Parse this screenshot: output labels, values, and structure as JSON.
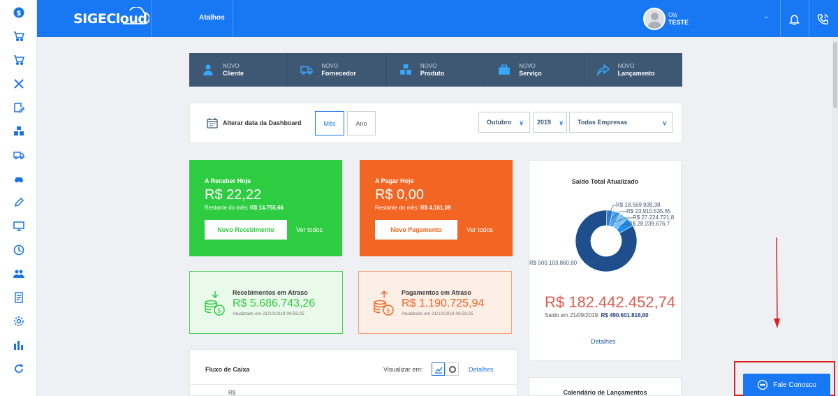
{
  "topbar": {
    "logo": "SIGECloud",
    "shortcuts_label": "Atalhos",
    "greeting": "Olá",
    "user_name": "TESTE"
  },
  "sidebar": {
    "icons": [
      "dollar-icon",
      "cart-icon",
      "cart-check-icon",
      "tools-icon",
      "edit-icon",
      "boxes-icon",
      "truck-icon",
      "car-icon",
      "pencil-icon",
      "monitor-icon",
      "clock-icon",
      "users-icon",
      "report-icon",
      "gear-icon",
      "bar-chart-icon",
      "refresh-icon"
    ]
  },
  "quickbar": {
    "items": [
      {
        "small": "NOVO",
        "label": "Cliente",
        "icon": "person-icon"
      },
      {
        "small": "NOVO",
        "label": "Fornecedor",
        "icon": "truck-icon"
      },
      {
        "small": "NOVO",
        "label": "Produto",
        "icon": "boxes-icon"
      },
      {
        "small": "NOVO",
        "label": "Serviço",
        "icon": "briefcase-icon"
      },
      {
        "small": "NOVO",
        "label": "Lançamento",
        "icon": "share-icon"
      }
    ]
  },
  "filters": {
    "label": "Alterar data da Dashboard",
    "month_btn": "Mês",
    "year_btn": "Ano",
    "month": "Outubro",
    "year": "2019",
    "company": "Todas Empresas"
  },
  "receber": {
    "title": "A Receber Hoje",
    "value": "R$ 22,22",
    "rest_label": "Restante do mês:",
    "rest_value": "R$ 14.755,66",
    "button": "Novo Recebimento",
    "link": "Ver todos",
    "color": "#2ecc40"
  },
  "pagar": {
    "title": "A Pagar Hoje",
    "value": "R$ 0,00",
    "rest_label": "Restante do mês:",
    "rest_value": "R$ 4.161,09",
    "button": "Novo Pagamento",
    "link": "Ver todos",
    "color": "#f26522"
  },
  "atraso_receb": {
    "title": "Recebimentos em Atraso",
    "value": "R$ 5.686.743,26",
    "updated": "Atualizado em 21/10/2019 08:56:25"
  },
  "atraso_pag": {
    "title": "Pagamentos em Atraso",
    "value": "R$ 1.190.725,94",
    "updated": "Atualizado em 21/10/2019 08:56:25"
  },
  "cashflow": {
    "title": "Fluxo de Caixa",
    "view_label": "Visualizar em:",
    "details": "Detalhes",
    "currency": "R$"
  },
  "balance": {
    "title": "Saldo Total Atualizado",
    "value": "R$ 182.442.452,74",
    "sub_label": "Saldo em 21/09/2019:",
    "sub_value": "R$ 490.601.818,60",
    "details": "Detalhes",
    "chart_data": {
      "type": "pie",
      "values": [
        500103860.8,
        18569939.38,
        23910535.65,
        27224721.88,
        28239676.78
      ],
      "labels": [
        "R$ 500.103.860,80",
        "R$ 18.569.939,38",
        "R$ 23.910.535,65",
        "R$ 27.224.721,8",
        "R$ 28.239.676,7"
      ],
      "colors": [
        "#1e4f8c",
        "#2f7fd6",
        "#4aa3ef",
        "#7bc3f7",
        "#1b90f0"
      ]
    }
  },
  "calendar": {
    "title": "Calendário de Lançamentos"
  },
  "fale": {
    "label": "Fale Conosco"
  }
}
